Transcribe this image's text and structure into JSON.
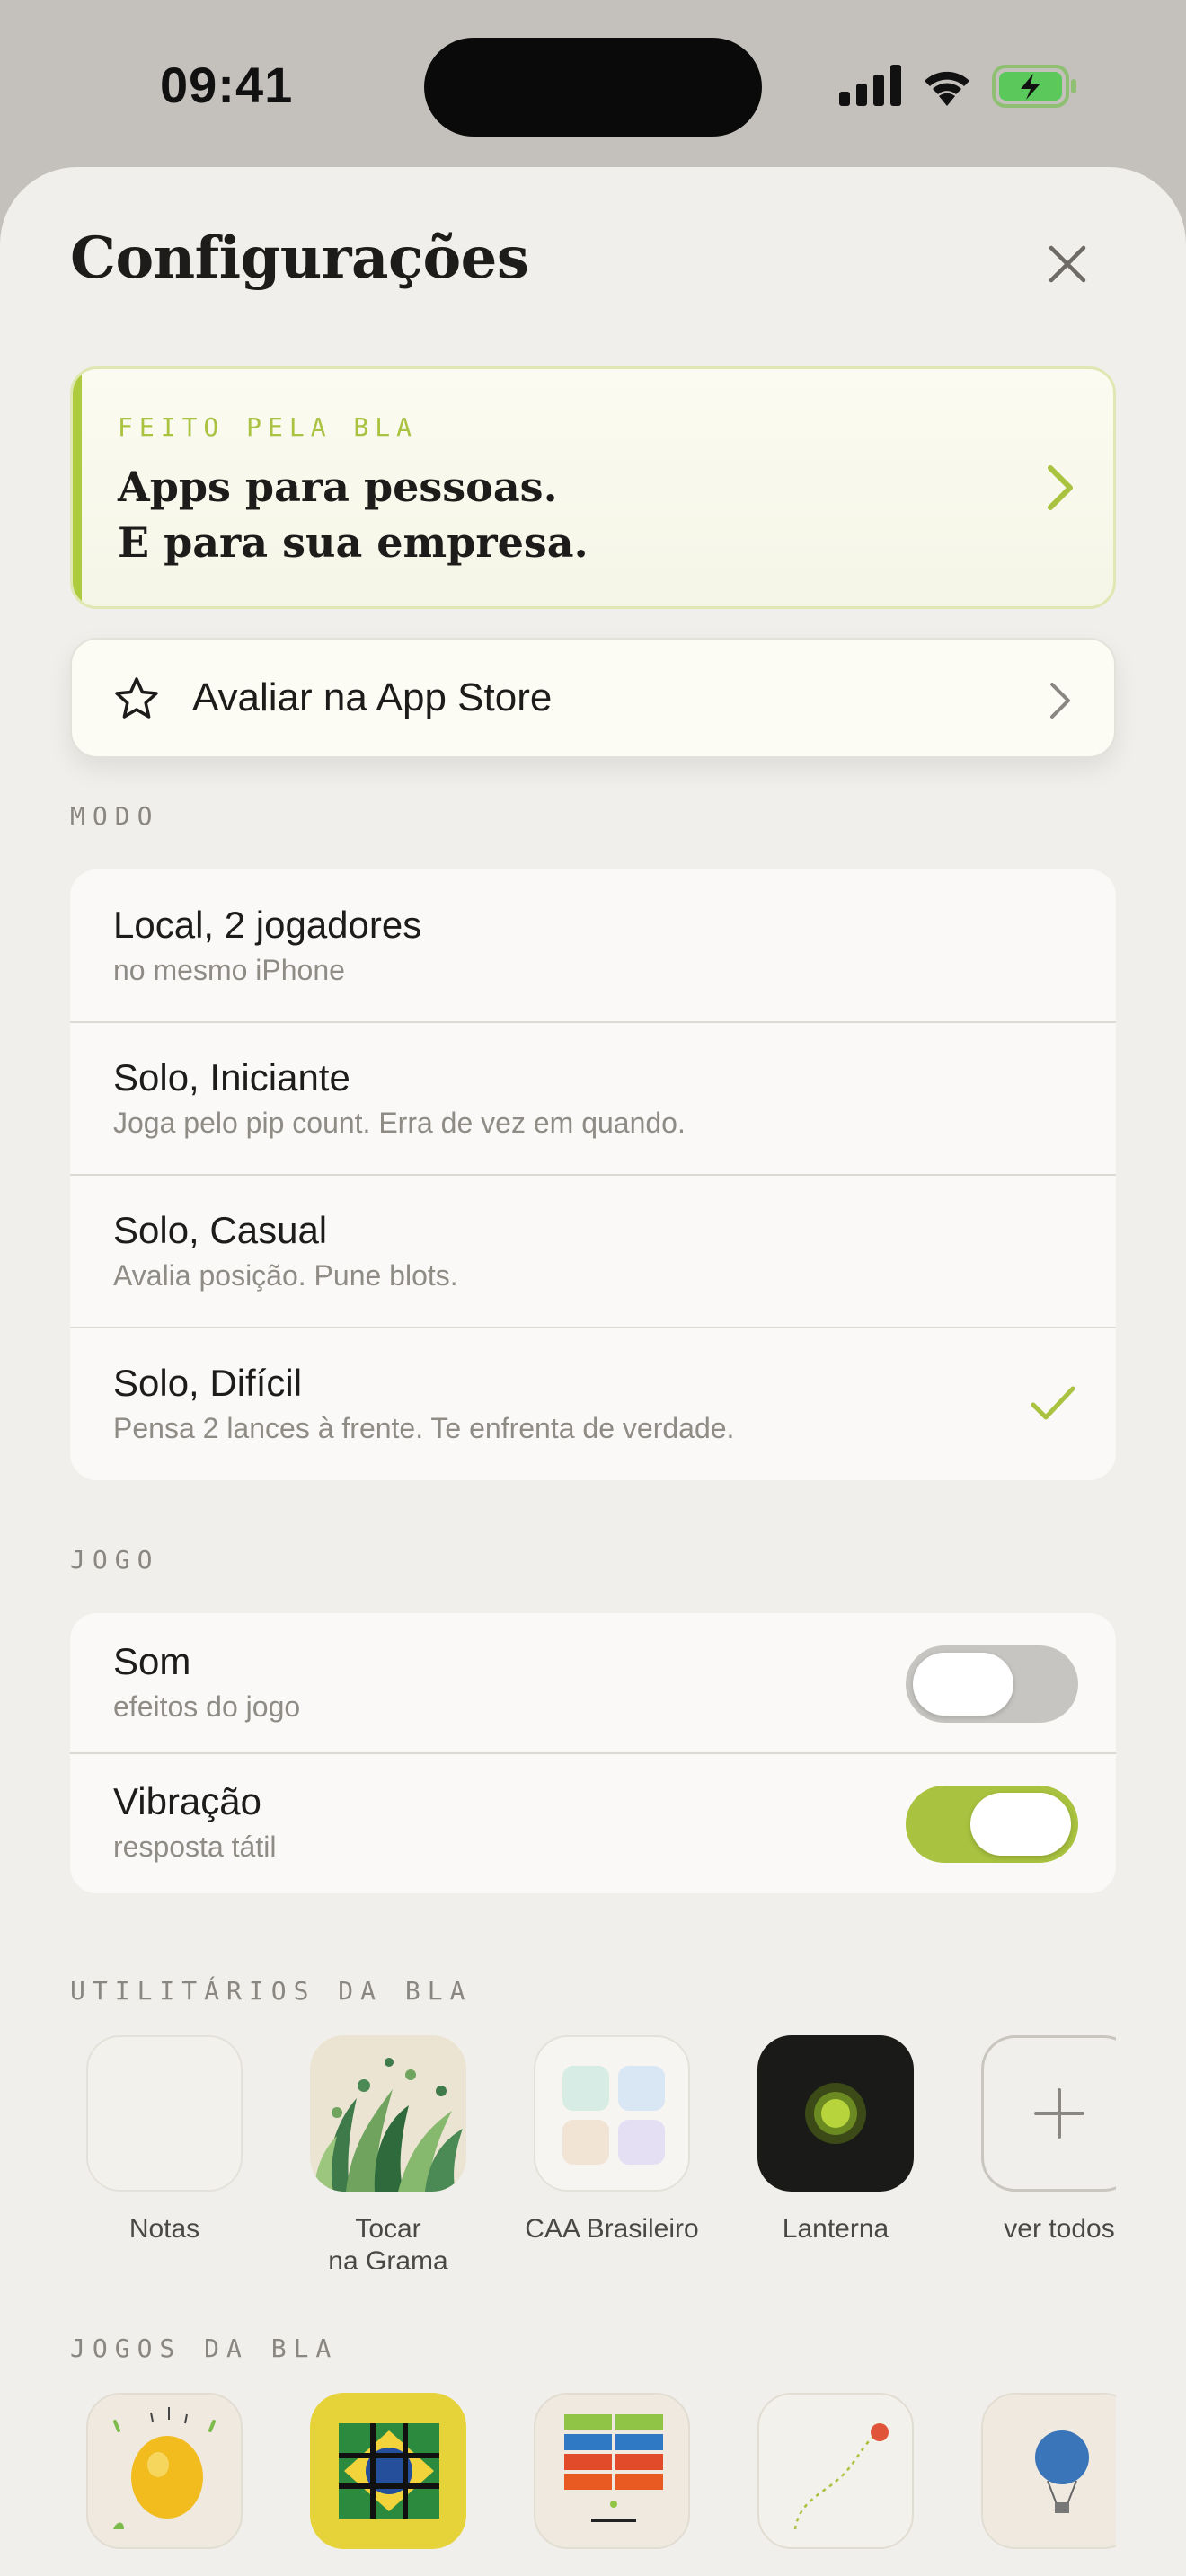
{
  "status": {
    "time": "09:41"
  },
  "sheet": {
    "title": "Configurações"
  },
  "promo": {
    "kicker": "FEITO PELA BLA",
    "line1": "Apps para pessoas.",
    "line2": "E para sua empresa."
  },
  "rate": {
    "label": "Avaliar na App Store"
  },
  "modo": {
    "header": "MODO",
    "options": [
      {
        "title": "Local, 2 jogadores",
        "subtitle": "no mesmo iPhone",
        "selected": false
      },
      {
        "title": "Solo, Iniciante",
        "subtitle": "Joga pelo pip count. Erra de vez em quando.",
        "selected": false
      },
      {
        "title": "Solo, Casual",
        "subtitle": "Avalia posição. Pune blots.",
        "selected": false
      },
      {
        "title": "Solo, Difícil",
        "subtitle": "Pensa 2 lances à frente. Te enfrenta de verdade.",
        "selected": true
      }
    ]
  },
  "jogo": {
    "header": "JOGO",
    "settings": [
      {
        "title": "Som",
        "subtitle": "efeitos do jogo",
        "on": false
      },
      {
        "title": "Vibração",
        "subtitle": "resposta tátil",
        "on": true
      }
    ]
  },
  "utilitarios": {
    "header": "UTILITÁRIOS DA BLA",
    "apps": [
      {
        "label": "Notas",
        "icon": "notes-icon"
      },
      {
        "label": "Tocar\nna Grama",
        "icon": "grass-icon"
      },
      {
        "label": "CAA Brasileiro",
        "icon": "aac-grid-icon"
      },
      {
        "label": "Lanterna",
        "icon": "flashlight-icon"
      },
      {
        "label": "ver todos",
        "icon": "plus-icon"
      }
    ]
  },
  "jogos": {
    "header": "JOGOS DA BLA",
    "apps": [
      {
        "icon": "egg-game-icon"
      },
      {
        "icon": "brazil-puzzle-icon"
      },
      {
        "icon": "color-blocks-icon"
      },
      {
        "icon": "golf-path-icon"
      },
      {
        "icon": "balloon-icon"
      }
    ]
  },
  "colors": {
    "accent": "#a9c23f",
    "sheet_bg": "#f1efeb",
    "card_bg": "#faf9f7"
  }
}
